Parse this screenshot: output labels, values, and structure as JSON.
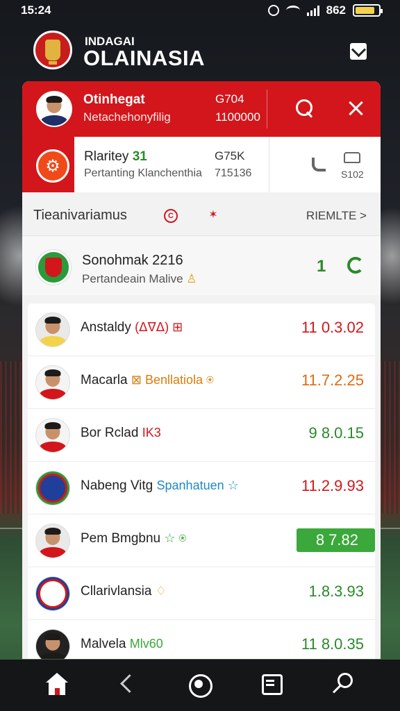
{
  "status_bar": {
    "time": "15:24",
    "battery": "862"
  },
  "header": {
    "subtitle": "INDAGAI",
    "title": "OLAINASIA"
  },
  "player_header": {
    "name": "Otinhegat",
    "subtitle": "Netachehonyfilig",
    "code": "G704",
    "number": "1100000"
  },
  "contact": {
    "name": "Rlaritey",
    "name_number": "31",
    "subtitle": "Pertanting Klanchenthia",
    "code": "G75K",
    "number": "715136",
    "code2": "S102"
  },
  "section": {
    "title": "Tieanivariamus",
    "link": "RIEMLTE >"
  },
  "featured": {
    "name": "Sonohmak 2216",
    "subtitle": "Pertandeain Malive",
    "count": "1"
  },
  "players": [
    {
      "name": "Anstaldy",
      "extra": "(ᐃᐁᐃ) ⊞",
      "extra_color": "#d2161b",
      "score": "11 0.3.02",
      "score_color": "#d2161b"
    },
    {
      "name": "Macarla",
      "extra": "⊠ Benllatiola ⍟",
      "extra_color": "#d97d0b",
      "score": "11.7.2.25",
      "score_color": "#e06a10"
    },
    {
      "name": "Bor Rclad",
      "extra": "IK3",
      "extra_color": "#d2161b",
      "score": "9 8.0.15",
      "score_color": "#2a8a2a"
    },
    {
      "name": "Nabeng Vitg",
      "extra": "Spanhatuen ☆",
      "extra_color": "#1f8ac0",
      "score": "11.2.9.93",
      "score_color": "#d2161b"
    },
    {
      "name": "Pem Bmgbnu",
      "extra": "☆ ⍟",
      "extra_color": "#3aa83a",
      "score": "8 7.82",
      "score_color": "#ffffff"
    },
    {
      "name": "Cllarivlansia",
      "extra": "♢",
      "extra_color": "#e6a019",
      "score": "1.8.3.93",
      "score_color": "#2a8a2a"
    },
    {
      "name": "Malvela",
      "extra": "Mlv60",
      "extra_color": "#3aa83a",
      "score": "11 8.0.35",
      "score_color": "#2a8a2a"
    }
  ],
  "colors": {
    "accent": "#d2161b",
    "positive": "#2a8a2a",
    "warning": "#e6a019"
  }
}
